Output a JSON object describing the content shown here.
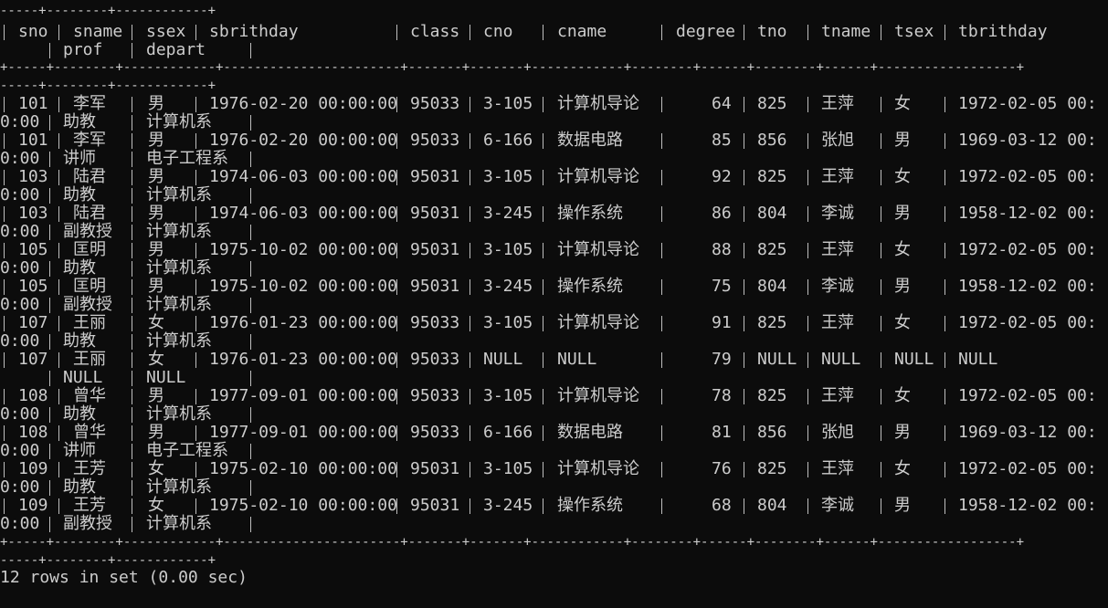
{
  "terminal": {
    "top_border": "-----+--------+------------+",
    "border_line": "+-----+--------+------------+-----------------------+-------+-------+------------+--------+------+--------+------+------------------+",
    "header_row1": [
      "sno",
      "sname",
      "ssex",
      "sbrithday",
      "class",
      "cno",
      "cname",
      "degree",
      "tno",
      "tname",
      "tsex",
      "tbrithday"
    ],
    "header_row2": [
      "prof",
      "depart"
    ],
    "rows": [
      {
        "sno": "101",
        "sname": "李军",
        "ssex": "男",
        "sbrithday": "1976-02-20 00:00:00",
        "class": "95033",
        "cno": "3-105",
        "cname": "计算机导论",
        "degree": "64",
        "tno": "825",
        "tname": "王萍",
        "tsex": "女",
        "tbrithday": "1972-02-05 00:0",
        "cont": "0:00",
        "prof": "助教",
        "depart": "计算机系"
      },
      {
        "sno": "101",
        "sname": "李军",
        "ssex": "男",
        "sbrithday": "1976-02-20 00:00:00",
        "class": "95033",
        "cno": "6-166",
        "cname": "数据电路",
        "degree": "85",
        "tno": "856",
        "tname": "张旭",
        "tsex": "男",
        "tbrithday": "1969-03-12 00:0",
        "cont": "0:00",
        "prof": "讲师",
        "depart": "电子工程系"
      },
      {
        "sno": "103",
        "sname": "陆君",
        "ssex": "男",
        "sbrithday": "1974-06-03 00:00:00",
        "class": "95031",
        "cno": "3-105",
        "cname": "计算机导论",
        "degree": "92",
        "tno": "825",
        "tname": "王萍",
        "tsex": "女",
        "tbrithday": "1972-02-05 00:0",
        "cont": "0:00",
        "prof": "助教",
        "depart": "计算机系"
      },
      {
        "sno": "103",
        "sname": "陆君",
        "ssex": "男",
        "sbrithday": "1974-06-03 00:00:00",
        "class": "95031",
        "cno": "3-245",
        "cname": "操作系统",
        "degree": "86",
        "tno": "804",
        "tname": "李诚",
        "tsex": "男",
        "tbrithday": "1958-12-02 00:0",
        "cont": "0:00",
        "prof": "副教授",
        "depart": "计算机系"
      },
      {
        "sno": "105",
        "sname": "匡明",
        "ssex": "男",
        "sbrithday": "1975-10-02 00:00:00",
        "class": "95031",
        "cno": "3-105",
        "cname": "计算机导论",
        "degree": "88",
        "tno": "825",
        "tname": "王萍",
        "tsex": "女",
        "tbrithday": "1972-02-05 00:0",
        "cont": "0:00",
        "prof": "助教",
        "depart": "计算机系"
      },
      {
        "sno": "105",
        "sname": "匡明",
        "ssex": "男",
        "sbrithday": "1975-10-02 00:00:00",
        "class": "95031",
        "cno": "3-245",
        "cname": "操作系统",
        "degree": "75",
        "tno": "804",
        "tname": "李诚",
        "tsex": "男",
        "tbrithday": "1958-12-02 00:0",
        "cont": "0:00",
        "prof": "副教授",
        "depart": "计算机系"
      },
      {
        "sno": "107",
        "sname": "王丽",
        "ssex": "女",
        "sbrithday": "1976-01-23 00:00:00",
        "class": "95033",
        "cno": "3-105",
        "cname": "计算机导论",
        "degree": "91",
        "tno": "825",
        "tname": "王萍",
        "tsex": "女",
        "tbrithday": "1972-02-05 00:0",
        "cont": "0:00",
        "prof": "助教",
        "depart": "计算机系"
      },
      {
        "sno": "107",
        "sname": "王丽",
        "ssex": "女",
        "sbrithday": "1976-01-23 00:00:00",
        "class": "95033",
        "cno": "NULL",
        "cname": "NULL",
        "degree": "79",
        "tno": "NULL",
        "tname": "NULL",
        "tsex": "NULL",
        "tbrithday": "NULL",
        "cont": "",
        "prof": "NULL",
        "depart": "NULL"
      },
      {
        "sno": "108",
        "sname": "曾华",
        "ssex": "男",
        "sbrithday": "1977-09-01 00:00:00",
        "class": "95033",
        "cno": "3-105",
        "cname": "计算机导论",
        "degree": "78",
        "tno": "825",
        "tname": "王萍",
        "tsex": "女",
        "tbrithday": "1972-02-05 00:0",
        "cont": "0:00",
        "prof": "助教",
        "depart": "计算机系"
      },
      {
        "sno": "108",
        "sname": "曾华",
        "ssex": "男",
        "sbrithday": "1977-09-01 00:00:00",
        "class": "95033",
        "cno": "6-166",
        "cname": "数据电路",
        "degree": "81",
        "tno": "856",
        "tname": "张旭",
        "tsex": "男",
        "tbrithday": "1969-03-12 00:0",
        "cont": "0:00",
        "prof": "讲师",
        "depart": "电子工程系"
      },
      {
        "sno": "109",
        "sname": "王芳",
        "ssex": "女",
        "sbrithday": "1975-02-10 00:00:00",
        "class": "95031",
        "cno": "3-105",
        "cname": "计算机导论",
        "degree": "76",
        "tno": "825",
        "tname": "王萍",
        "tsex": "女",
        "tbrithday": "1972-02-05 00:0",
        "cont": "0:00",
        "prof": "助教",
        "depart": "计算机系"
      },
      {
        "sno": "109",
        "sname": "王芳",
        "ssex": "女",
        "sbrithday": "1975-02-10 00:00:00",
        "class": "95031",
        "cno": "3-245",
        "cname": "操作系统",
        "degree": "68",
        "tno": "804",
        "tname": "李诚",
        "tsex": "男",
        "tbrithday": "1958-12-02 00:0",
        "cont": "0:00",
        "prof": "副教授",
        "depart": "计算机系"
      }
    ],
    "footer": "12 rows in set (0.00 sec)"
  }
}
